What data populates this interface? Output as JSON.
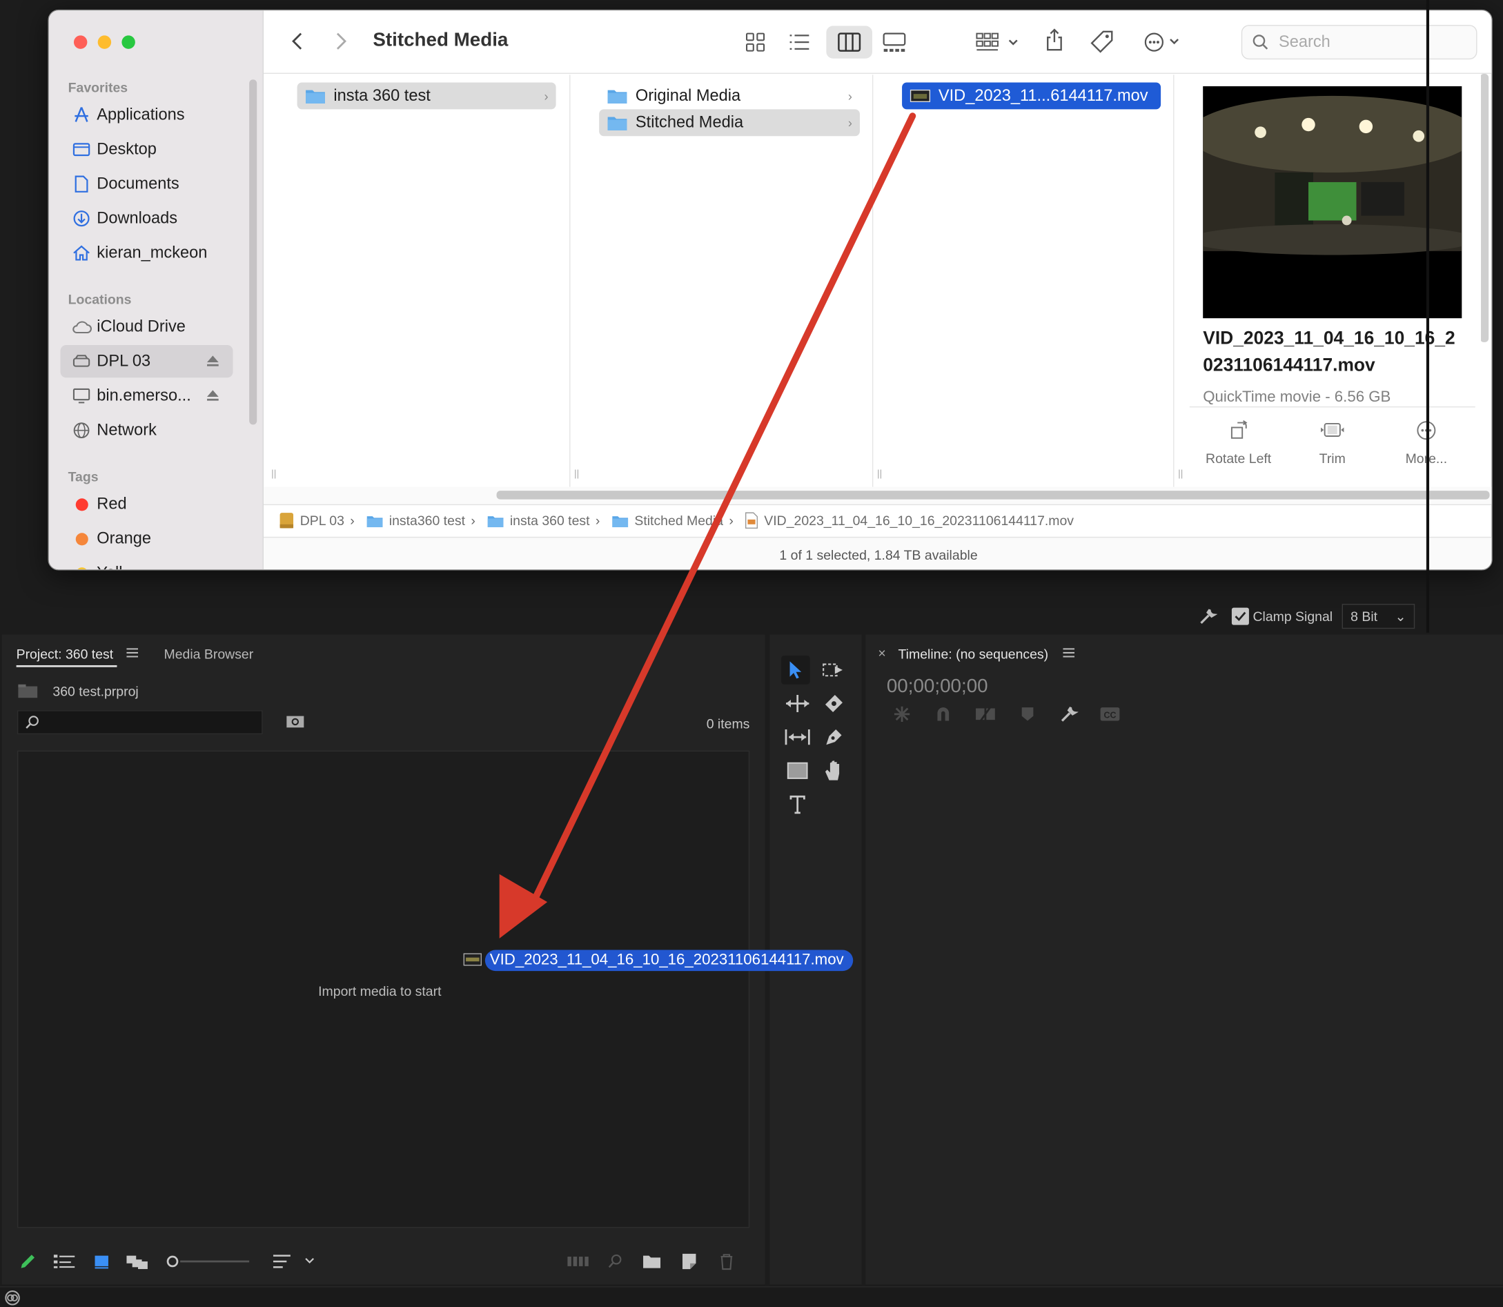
{
  "finder": {
    "title": "Stitched Media",
    "search_placeholder": "Search",
    "sidebar": {
      "favorites_header": "Favorites",
      "favorites": [
        "Applications",
        "Desktop",
        "Documents",
        "Downloads",
        "kieran_mckeon"
      ],
      "locations_header": "Locations",
      "locations": [
        "iCloud Drive",
        "DPL 03",
        "bin.emerso..."
      ],
      "network": "Network",
      "tags_header": "Tags",
      "tags": [
        {
          "label": "Red",
          "color": "#ff3b30"
        },
        {
          "label": "Orange",
          "color": "#f5863a"
        },
        {
          "label": "Yell",
          "color": "#f7c531"
        }
      ]
    },
    "columns": {
      "col1": [
        "insta 360 test"
      ],
      "col2": [
        "Original Media",
        "Stitched Media"
      ],
      "col3": [
        "VID_2023_11...6144117.mov"
      ]
    },
    "preview": {
      "filename": "VID_2023_11_04_16_10_16_20231106144117.mov",
      "filename_line1": "VID_2023_11_04_16_10_16_2",
      "filename_line2": "0231106144117.mov",
      "kind": "QuickTime movie - 6.56 GB",
      "actions": [
        "Rotate Left",
        "Trim",
        "More..."
      ]
    },
    "path": [
      "DPL 03",
      "insta360 test",
      "insta 360 test",
      "Stitched Media",
      "VID_2023_11_04_16_10_16_20231106144117.mov"
    ],
    "status": "1 of 1 selected, 1.84 TB available"
  },
  "premiere": {
    "clamp_signal": "Clamp Signal",
    "bit_depth": "8 Bit",
    "project_tab": "Project: 360 test",
    "media_browser_tab": "Media Browser",
    "project_file": "360 test.prproj",
    "items_count": "0 items",
    "import_hint": "Import media to start",
    "dragged_file": "VID_2023_11_04_16_10_16_20231106144117.mov",
    "timeline_tab": "Timeline: (no sequences)",
    "timecode": "00;00;00;00"
  },
  "colors": {
    "arrow": "#d7392a",
    "selection": "#1f5bd6",
    "finder_folder": "#5aa7e8"
  }
}
